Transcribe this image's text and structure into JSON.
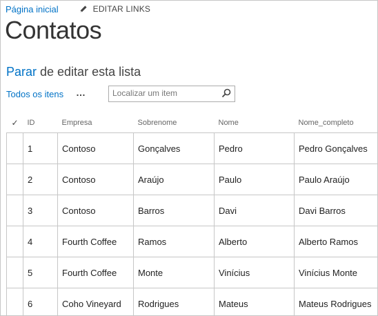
{
  "topnav": {
    "home_label": "Página inicial",
    "edit_links_label": "EDITAR LINKS"
  },
  "page": {
    "title": "Contatos",
    "stop_editing_link": "Parar",
    "stop_editing_rest": " de editar esta lista"
  },
  "toolbar": {
    "all_items_label": "Todos os itens",
    "more_label": "…",
    "search_placeholder": "Localizar um item"
  },
  "table": {
    "check_symbol": "✓",
    "headers": [
      "ID",
      "Empresa",
      "Sobrenome",
      "Nome",
      "Nome_completo"
    ],
    "rows": [
      [
        "1",
        "Contoso",
        "Gonçalves",
        "Pedro",
        "Pedro Gonçalves"
      ],
      [
        "2",
        "Contoso",
        "Araújo",
        "Paulo",
        "Paulo Araújo"
      ],
      [
        "3",
        "Contoso",
        "Barros",
        "Davi",
        "Davi Barros"
      ],
      [
        "4",
        "Fourth Coffee",
        "Ramos",
        "Alberto",
        "Alberto Ramos"
      ],
      [
        "5",
        "Fourth Coffee",
        "Monte",
        "Vinícius",
        "Vinícius Monte"
      ],
      [
        "6",
        "Coho Vineyard",
        "Rodrigues",
        "Mateus",
        "Mateus Rodrigues"
      ]
    ]
  },
  "colors": {
    "link": "#0072c6",
    "border": "#c6c6c6",
    "text": "#333333"
  }
}
